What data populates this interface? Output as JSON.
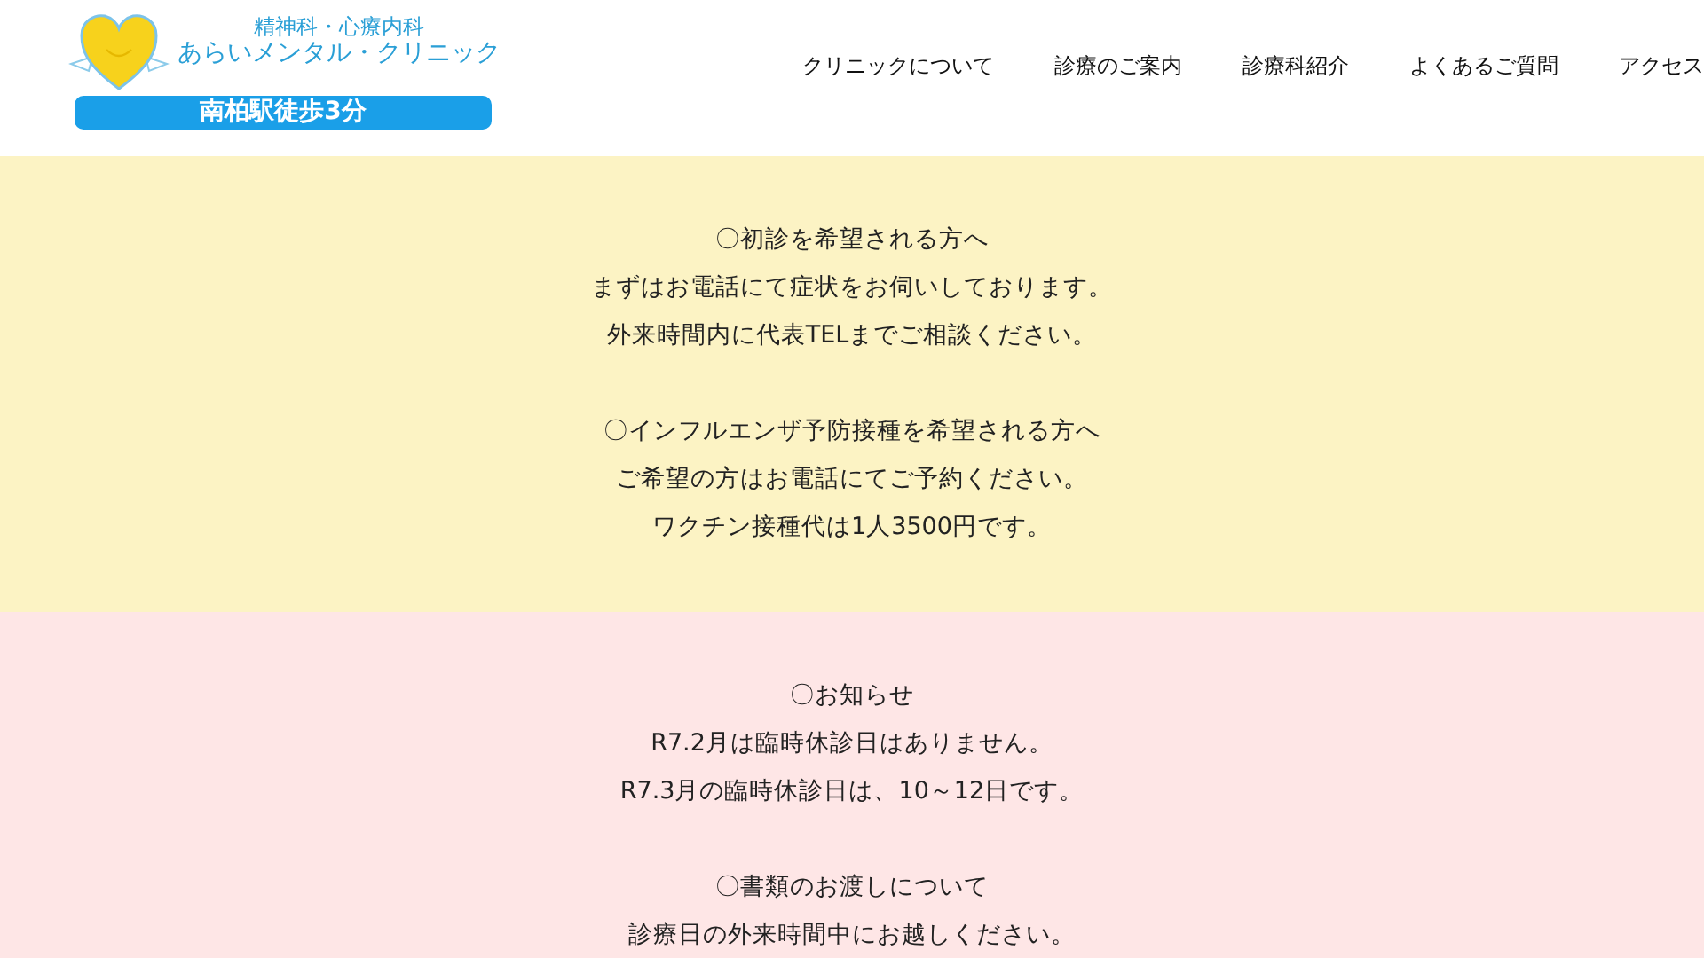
{
  "header": {
    "logo_subtitle": "精神科・心療内科",
    "logo_title": "あらいメンタル・クリニック",
    "station_badge": "南柏駅徒歩3分"
  },
  "nav": [
    {
      "label": "クリニックについて"
    },
    {
      "label": "診療のご案内"
    },
    {
      "label": "診療科紹介"
    },
    {
      "label": "よくあるご質問"
    },
    {
      "label": "アクセス"
    }
  ],
  "sections": [
    {
      "color": "#fcf3c4",
      "paragraphs": [
        [
          "〇初診を希望される方へ",
          "まずはお電話にて症状をお伺いしております。",
          "外来時間内に代表TELまでご相談ください。"
        ],
        [
          "〇インフルエンザ予防接種を希望される方へ",
          "ご希望の方はお電話にてご予約ください。",
          "ワクチン接種代は1人3500円です。"
        ]
      ]
    },
    {
      "color": "#fee6e6",
      "paragraphs": [
        [
          "〇お知らせ",
          "R7.2月は臨時休診日はありません。",
          "R7.3月の臨時休診日は、10～12日です。"
        ],
        [
          "〇書類のお渡しについて",
          "診療日の外来時間中にお越しください。"
        ]
      ]
    }
  ]
}
